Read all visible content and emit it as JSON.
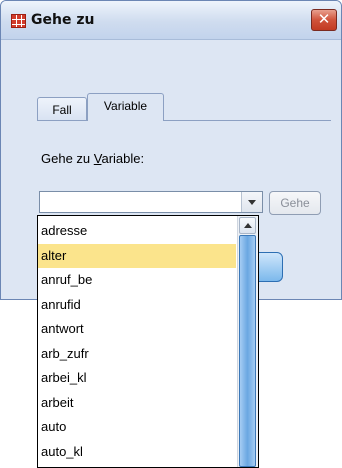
{
  "window": {
    "title": "Gehe zu"
  },
  "tabs": [
    {
      "label": "Fall"
    },
    {
      "label": "Variable"
    }
  ],
  "form": {
    "label_prefix": "Gehe zu ",
    "label_accel": "V",
    "label_suffix": "ariable:",
    "combo_value": "",
    "go_button": "Gehe"
  },
  "dropdown": {
    "selected": "alter",
    "items": [
      "adresse",
      "alter",
      "anruf_be",
      "anrufid",
      "antwort",
      "arb_zufr",
      "arbei_kl",
      "arbeit",
      "auto",
      "auto_kl"
    ]
  },
  "icons": {
    "app": "spreadsheet-grid-icon",
    "close": "close-icon",
    "combo_arrow": "chevron-down-icon",
    "scroll_up": "arrow-up-icon"
  },
  "colors": {
    "close_button": "#c23a22",
    "selection": "#fbe48c",
    "thumb": "#6aa7e2"
  }
}
